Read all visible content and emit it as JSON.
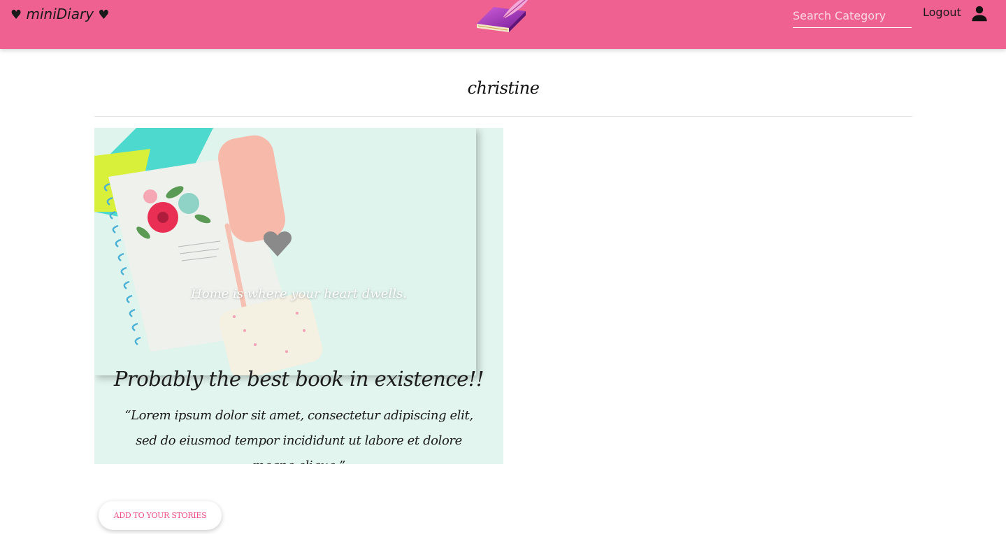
{
  "header": {
    "brand": {
      "heart_left": "♥",
      "name": "miniDiary",
      "heart_right": "♥"
    },
    "logo_icon": "diary-book-quill-icon",
    "search": {
      "placeholder": "Search Category",
      "value": ""
    },
    "logout_label": "Logout",
    "user_icon": "person-icon",
    "background_color": "#ee6190"
  },
  "page": {
    "title": "christine"
  },
  "card": {
    "image_caption": "Home is where your heart dwells.",
    "heading": "Probably the best book in existence!!",
    "text": "“Lorem ipsum dolor sit amet, consectetur adipiscing elit, sed do eiusmod tempor incididunt ut labore et dolore magna aliqua.”",
    "background_color": "#e2f5ee"
  },
  "actions": {
    "add_label": "ADD TO YOUR STORIES",
    "accent_color": "#ee4d86"
  }
}
